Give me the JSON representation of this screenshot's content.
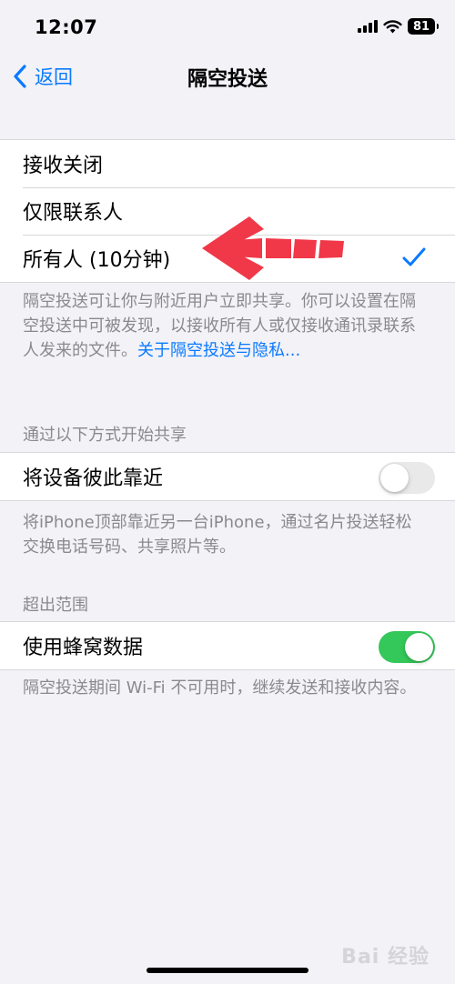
{
  "status_bar": {
    "time": "12:07",
    "battery": "81"
  },
  "nav": {
    "back_label": "返回",
    "title": "隔空投送"
  },
  "receive_options": {
    "items": [
      {
        "label": "接收关闭",
        "selected": false
      },
      {
        "label": "仅限联系人",
        "selected": false
      },
      {
        "label": "所有人 (10分钟)",
        "selected": true
      }
    ],
    "footer_text": "隔空投送可让你与附近用户立即共享。你可以设置在隔空投送中可被发现，以接收所有人或仅接收通讯录联系人发来的文件。",
    "footer_link": "关于隔空投送与隐私..."
  },
  "start_sharing": {
    "header": "通过以下方式开始共享",
    "row_label": "将设备彼此靠近",
    "toggle_on": false,
    "footer_text": "将iPhone顶部靠近另一台iPhone，通过名片投送轻松交换电话号码、共享照片等。"
  },
  "out_of_range": {
    "header": "超出范围",
    "row_label": "使用蜂窝数据",
    "toggle_on": true,
    "footer_text": "隔空投送期间 Wi-Fi 不可用时，继续发送和接收内容。"
  },
  "watermark": "Bai 经验",
  "colors": {
    "accent": "#0a7aff",
    "toggle_on": "#34c759",
    "annotation": "#f03848"
  }
}
